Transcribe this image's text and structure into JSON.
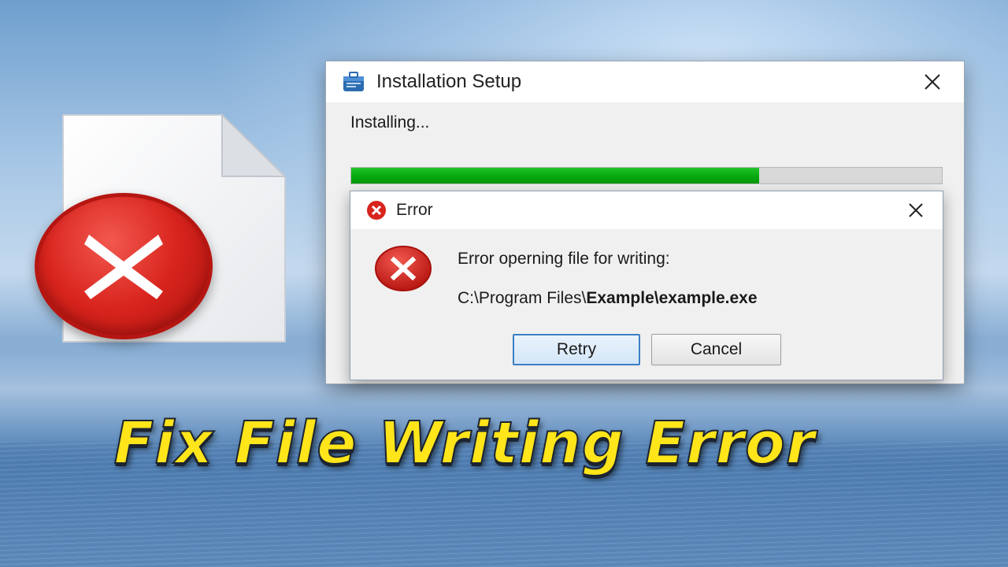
{
  "installer": {
    "title": "Installation Setup",
    "status": "Installing...",
    "progress_fraction": 0.69
  },
  "error_dialog": {
    "title": "Error",
    "message": "Error operning file for writing:",
    "path_prefix": "C:\\Program Files\\",
    "path_folder": "Example",
    "path_sep": "\\",
    "path_file": "example.exe",
    "retry_label": "Retry",
    "cancel_label": "Cancel"
  },
  "headline": "Fix File Writing Error",
  "colors": {
    "progress_green": "#0aac13",
    "error_red": "#d8241d",
    "headline_yellow": "#ffe51a",
    "focus_blue": "#3c7fc4"
  },
  "icons": {
    "file": "document-icon",
    "big_error": "error-circle-icon",
    "app": "installer-icon",
    "close": "close-icon",
    "dialog_error": "error-icon"
  }
}
